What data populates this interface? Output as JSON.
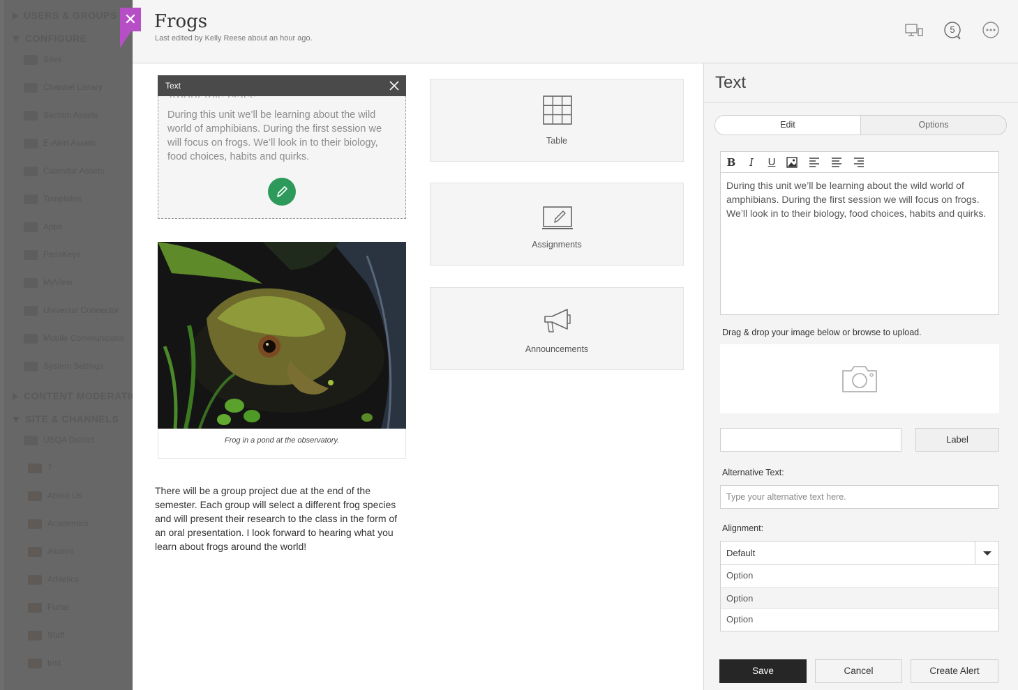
{
  "sidebar": {
    "sections": [
      "USERS & GROUPS",
      "CONFIGURE",
      "CONTENT MODERATION",
      "SITE & CHANNELS"
    ],
    "configure_items": [
      "Sites",
      "Channel Library",
      "Section Assets",
      "E-Alert Assets",
      "Calendar Assets",
      "Templates",
      "Apps",
      "PassKeys",
      "MyView",
      "Universal Connector",
      "Mobile Communicator",
      "System Settings"
    ],
    "site_items": [
      "USQA District",
      "7",
      "About Us",
      "Academics",
      "Alumni",
      "Athletics",
      "Furtal",
      "Staff",
      "test"
    ]
  },
  "header": {
    "title": "Frogs",
    "subtitle": "Last edited by Kelly Reese about an hour ago.",
    "close_glyph": "✕",
    "comments_count": "5"
  },
  "text_block": {
    "bar_label": "Text",
    "heading": "About this class",
    "body": "During this unit we’ll be learning about the wild world of amphibians. During the first session we will focus on frogs. We’ll look in to their biology, food choices, habits and quirks."
  },
  "image_block": {
    "caption": "Frog in a pond at the observatory."
  },
  "paragraph": " There will be a group project due at the end of the semester. Each group will select a different frog species and will present their research to the class in the form of an oral presentation. I look forward to hearing what you learn about frogs around the world!",
  "tiles": [
    {
      "label": "Table",
      "icon": "table-icon"
    },
    {
      "label": "Assignments",
      "icon": "assignments-icon"
    },
    {
      "label": "Announcements",
      "icon": "megaphone-icon"
    }
  ],
  "panel": {
    "title": "Text",
    "tabs": {
      "edit": "Edit",
      "options": "Options"
    },
    "editor_text": "During this unit we’ll be learning about the wild world of amphibians. During the first session we will focus on frogs. We’ll look in to their biology, food choices, habits and quirks.",
    "toolbar": {
      "bold": "B",
      "italic": "I",
      "underline": "U"
    },
    "drag_label": "Drag & drop your image below or browse to upload.",
    "label_button": "Label",
    "alt_label": "Alternative Text:",
    "alt_placeholder": "Type your alternative text here.",
    "alignment_label": "Alignment:",
    "alignment_value": "Default",
    "options": [
      "Option",
      "Option",
      "Option"
    ],
    "buttons": {
      "save": "Save",
      "cancel": "Cancel",
      "create_alert": "Create Alert"
    }
  },
  "colors": {
    "accent_purple": "#b64ec6",
    "edit_green": "#2d9a5b",
    "save_dark": "#262626"
  }
}
